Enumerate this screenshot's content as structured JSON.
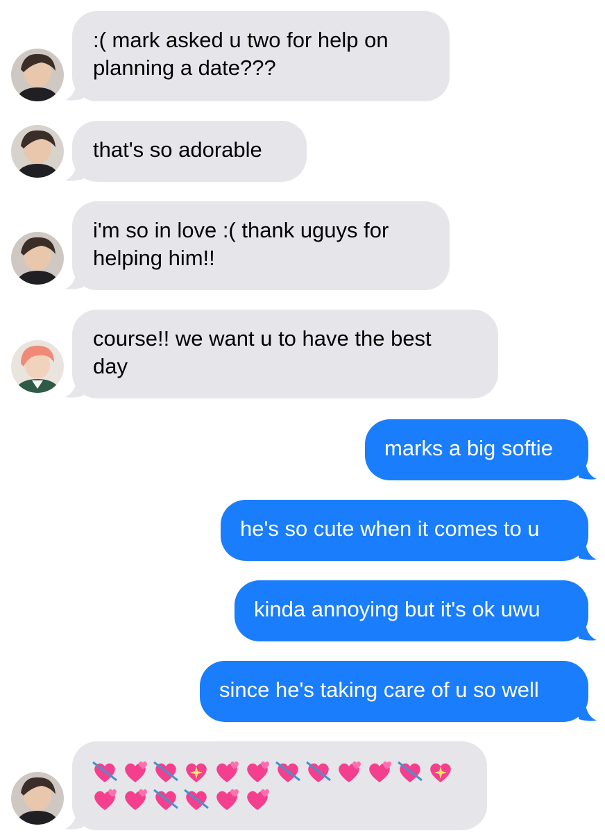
{
  "messages": [
    {
      "id": "m1",
      "direction": "incoming",
      "avatar": "avatar-boy-dark-hair",
      "text": ":( mark asked u two for help on\nplanning a date???"
    },
    {
      "id": "m2",
      "direction": "incoming",
      "avatar": "avatar-boy-dark-hair",
      "text": "that's so adorable"
    },
    {
      "id": "m3",
      "direction": "incoming",
      "avatar": "avatar-boy-dark-hair",
      "text": "i'm so in love :( thank uguys for\nhelping him!!"
    },
    {
      "id": "m4",
      "direction": "incoming",
      "avatar": "avatar-boy-pink-hair",
      "text": "course!! we want u to have the best\nday"
    },
    {
      "id": "m5",
      "direction": "outgoing",
      "text": "marks a big softie"
    },
    {
      "id": "m6",
      "direction": "outgoing",
      "text": "he's so cute when it comes to u"
    },
    {
      "id": "m7",
      "direction": "outgoing",
      "text": "kinda annoying but it's ok uwu"
    },
    {
      "id": "m8",
      "direction": "outgoing",
      "text": "since he's taking care of u so well"
    },
    {
      "id": "m9",
      "direction": "incoming",
      "avatar": "avatar-boy-dark-hair",
      "emoji_count": 18
    }
  ],
  "colors": {
    "incoming_bubble": "#e5e5ea",
    "outgoing_bubble": "#1a7dfb",
    "heart_pink": "#f43f8e"
  }
}
